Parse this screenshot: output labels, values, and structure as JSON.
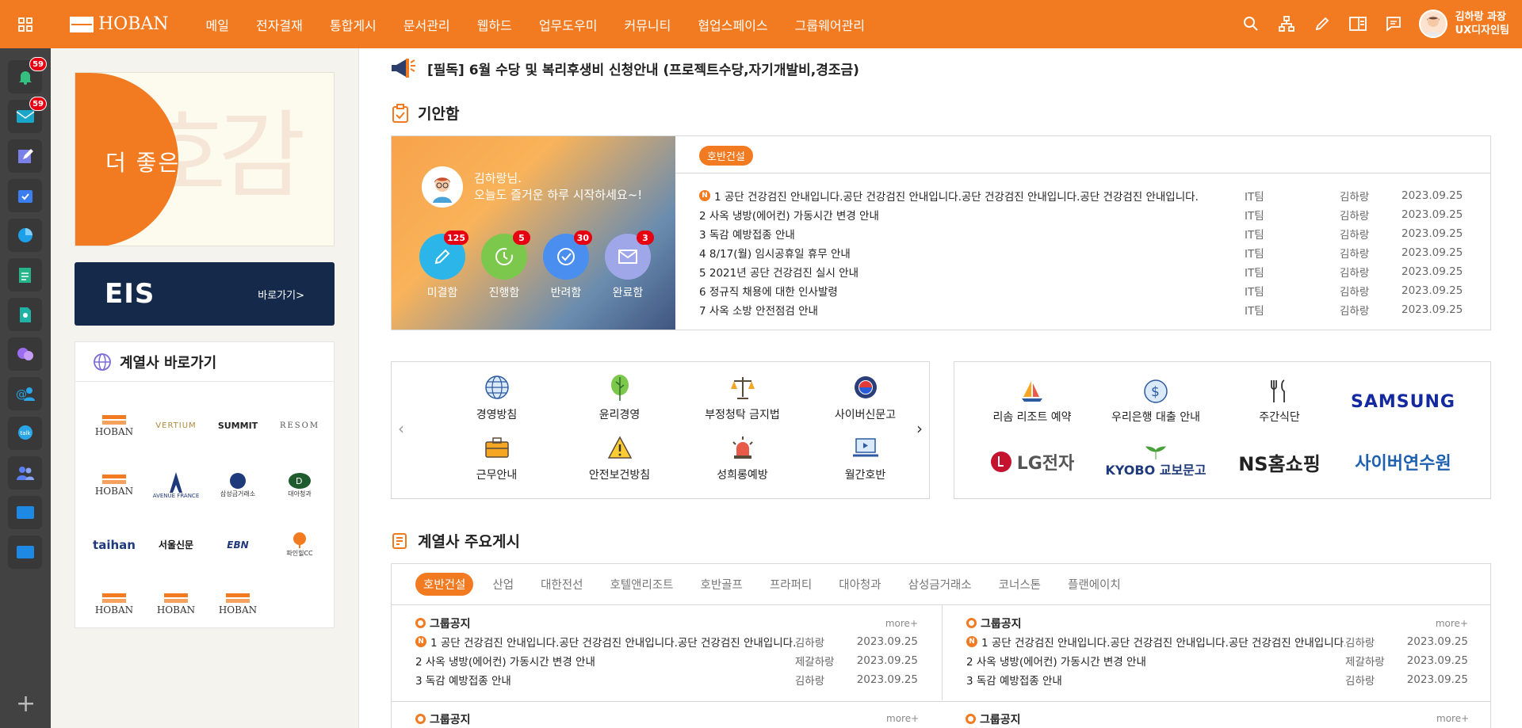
{
  "header": {
    "brand": "HOBAN",
    "nav": [
      "메일",
      "전자결재",
      "통합게시",
      "문서관리",
      "웹하드",
      "업무도우미",
      "커뮤니티",
      "협업스페이스",
      "그룹웨어관리"
    ],
    "user_name": "김하랑 과장",
    "user_dept": "UX디자인팀"
  },
  "leftbar": {
    "notify_badge": "59",
    "mail_badge": "59",
    "add_label": "+"
  },
  "lpanel": {
    "banner_text": "더 좋은",
    "banner_bg_text": "호감",
    "eis_title": "EIS",
    "eis_link": "바로가기>",
    "affiliates_title": "계열사 바로가기",
    "affiliates": [
      "HOBAN",
      "VERTIUM",
      "SUMMIT",
      "RESOM",
      "HOBAN",
      "AVENUE FRANCE",
      "삼성금거래소",
      "대아청과",
      "taihan",
      "서울신문",
      "EBN",
      "파인힐CC",
      "HOBAN",
      "HOBAN",
      "HOBAN"
    ]
  },
  "notice": "[필독] 6월 수당 및 복리후생비 신청안내 (프로젝트수당,자기개발비,경조금)",
  "draft": {
    "title": "기안함",
    "greeting_line1": "김하랑님.",
    "greeting_line2": "오늘도 즐거운 하루 시작하세요~!",
    "counters": [
      {
        "label": "미결함",
        "count": "125",
        "color": "#2bb5e8"
      },
      {
        "label": "진행함",
        "count": "5",
        "color": "#7cc84c"
      },
      {
        "label": "반려함",
        "count": "30",
        "color": "#4a8ef0"
      },
      {
        "label": "완료함",
        "count": "3",
        "color": "#9fa7e8"
      }
    ],
    "tab": "호반건설",
    "rows": [
      {
        "title": "1 공단 건강검진 안내입니다.공단 건강검진 안내입니다.공단 건강검진 안내입니다.공단 건강검진 안내입니다.",
        "dept": "IT팀",
        "author": "김하랑",
        "date": "2023.09.25",
        "isnew": "N"
      },
      {
        "title": "2 사옥 냉방(에어컨) 가동시간 변경 안내",
        "dept": "IT팀",
        "author": "김하랑",
        "date": "2023.09.25"
      },
      {
        "title": "3 독감 예방접종 안내",
        "dept": "IT팀",
        "author": "김하랑",
        "date": "2023.09.25"
      },
      {
        "title": "4 8/17(월) 임시공휴일 휴무 안내",
        "dept": "IT팀",
        "author": "김하랑",
        "date": "2023.09.25"
      },
      {
        "title": "5 2021년 공단 건강검진 실시 안내",
        "dept": "IT팀",
        "author": "김하랑",
        "date": "2023.09.25"
      },
      {
        "title": "6 정규직 채용에 대한 인사발령",
        "dept": "IT팀",
        "author": "김하랑",
        "date": "2023.09.25"
      },
      {
        "title": "7 사옥 소방 안전점검 안내",
        "dept": "IT팀",
        "author": "김하랑",
        "date": "2023.09.25"
      }
    ]
  },
  "quicklinks": [
    "경영방침",
    "윤리경영",
    "부정청탁 금지법",
    "사이버신문고",
    "근무안내",
    "안전보건방침",
    "성희롱예방",
    "월간호반"
  ],
  "partners": {
    "labels": [
      "리솜 리조트 예약",
      "우리은행 대출 안내",
      "주간식단"
    ],
    "logos": [
      "SAMSUNG",
      "LG전자",
      "KYOBO 교보문고",
      "NS홈쇼핑",
      "사이버연수원"
    ]
  },
  "posts": {
    "title": "계열사 주요게시",
    "tabs": [
      "호반건설",
      "산업",
      "대한전선",
      "호텔앤리조트",
      "호반골프",
      "프라퍼티",
      "대아청과",
      "삼성금거래소",
      "코너스톤",
      "플랜에이치"
    ],
    "section_label": "그룹공지",
    "more": "more+",
    "left": [
      {
        "title": "1 공단 건강검진 안내입니다.공단 건강검진 안내입니다.공단 건강검진 안내입니다.",
        "author": "김하랑",
        "date": "2023.09.25",
        "isnew": "N"
      },
      {
        "title": "2 사옥 냉방(에어컨) 가동시간 변경 안내",
        "author": "제갈하랑",
        "date": "2023.09.25"
      },
      {
        "title": "3 독감 예방접종 안내",
        "author": "김하랑",
        "date": "2023.09.25"
      }
    ],
    "right": [
      {
        "title": "1 공단 건강검진 안내입니다.공단 건강검진 안내입니다.공단 건강검진 안내입니다.",
        "author": "김하랑",
        "date": "2023.09.25",
        "isnew": "N"
      },
      {
        "title": "2 사옥 냉방(에어컨) 가동시간 변경 안내",
        "author": "제갈하랑",
        "date": "2023.09.25"
      },
      {
        "title": "3 독감 예방접종 안내",
        "author": "김하랑",
        "date": "2023.09.25"
      }
    ]
  },
  "colors": {
    "accent": "#f27b21",
    "sidebar": "#424242",
    "eis": "#152a4a"
  }
}
